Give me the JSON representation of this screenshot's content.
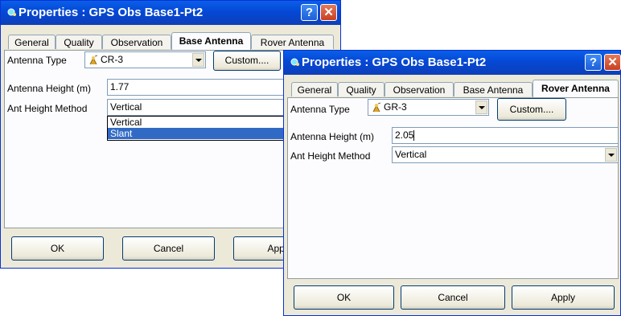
{
  "dialog_back": {
    "title": "Properties : GPS Obs Base1-Pt2",
    "tabs": [
      "General",
      "Quality",
      "Observation",
      "Base Antenna",
      "Rover Antenna"
    ],
    "active_tab": "Base Antenna",
    "antenna_type_label": "Antenna Type",
    "antenna_type_value": "CR-3",
    "custom_button": "Custom....",
    "antenna_height_label": "Antenna Height (m)",
    "antenna_height_value": "1.77",
    "ant_height_method_label": "Ant Height Method",
    "ant_height_method_value": "Vertical",
    "dropdown_options": [
      "Vertical",
      "Slant"
    ],
    "dropdown_highlighted": "Slant",
    "ok_button": "OK",
    "cancel_button": "Cancel",
    "apply_button": "Apply"
  },
  "dialog_front": {
    "title": "Properties : GPS Obs Base1-Pt2",
    "tabs": [
      "General",
      "Quality",
      "Observation",
      "Base Antenna",
      "Rover Antenna"
    ],
    "active_tab": "Rover Antenna",
    "antenna_type_label": "Antenna Type",
    "antenna_type_value": "GR-3",
    "custom_button": "Custom....",
    "antenna_height_label": "Antenna Height (m)",
    "antenna_height_value": "2.05",
    "ant_height_method_label": "Ant Height Method",
    "ant_height_method_value": "Vertical",
    "ok_button": "OK",
    "cancel_button": "Cancel",
    "apply_button": "Apply"
  },
  "colors": {
    "titlebar": "#0548d6",
    "dialog_bg": "#ece9d8",
    "selection": "#316ac5",
    "close_button": "#c8401f"
  },
  "icons": {
    "title": "satellite-dot-icon",
    "antenna": "antenna-icon",
    "help": "help-icon",
    "close": "close-icon"
  }
}
